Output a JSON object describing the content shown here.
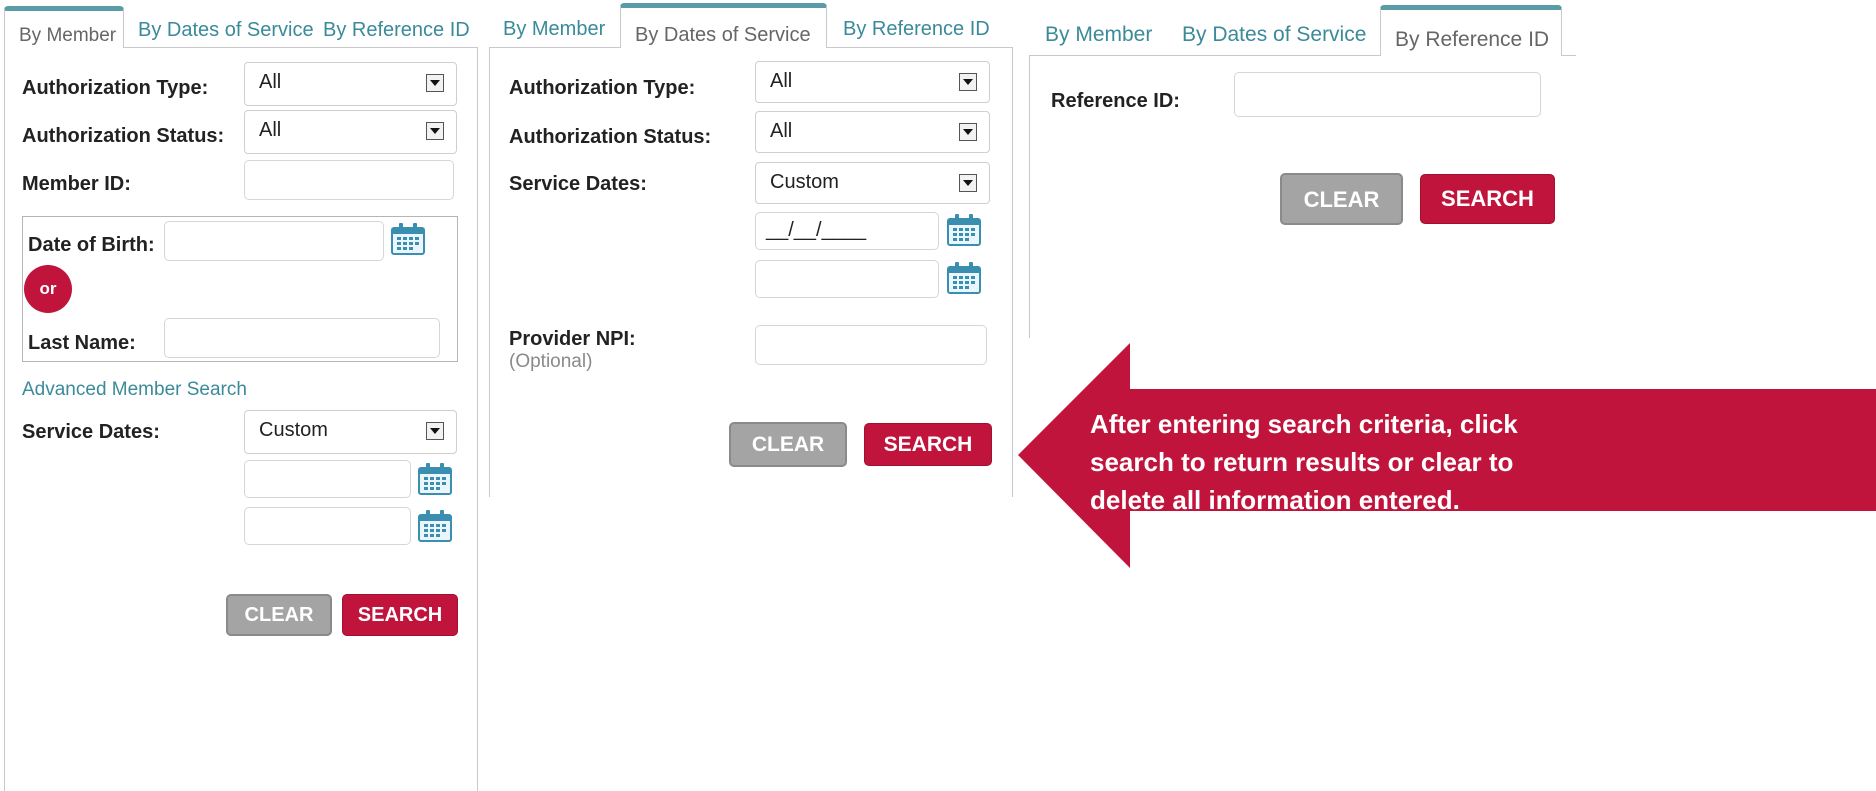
{
  "colors": {
    "accent": "#3a8a9a",
    "brand_red": "#c0143c",
    "button_gray": "#a4a4a4"
  },
  "panel1": {
    "tabs": [
      "By Member",
      "By Dates of Service",
      "By Reference ID"
    ],
    "auth_type_label": "Authorization Type:",
    "auth_type_value": "All",
    "auth_status_label": "Authorization Status:",
    "auth_status_value": "All",
    "member_id_label": "Member ID:",
    "member_id_value": "",
    "dob_label": "Date of Birth:",
    "dob_value": "",
    "or_label": "or",
    "last_name_label": "Last Name:",
    "last_name_value": "",
    "advanced_link": "Advanced Member Search",
    "service_dates_label": "Service Dates:",
    "service_dates_value": "Custom",
    "clear": "CLEAR",
    "search": "SEARCH"
  },
  "panel2": {
    "tabs": [
      "By Member",
      "By Dates of Service",
      "By Reference ID"
    ],
    "auth_type_label": "Authorization Type:",
    "auth_type_value": "All",
    "auth_status_label": "Authorization Status:",
    "auth_status_value": "All",
    "service_dates_label": "Service Dates:",
    "service_dates_value": "Custom",
    "start_date_mask": "__/__/____",
    "provider_npi_label": "Provider NPI:",
    "provider_npi_optional": "(Optional)",
    "clear": "CLEAR",
    "search": "SEARCH"
  },
  "panel3": {
    "tabs": [
      "By Member",
      "By Dates of Service",
      "By Reference ID"
    ],
    "reference_id_label": "Reference ID:",
    "reference_id_value": "",
    "clear": "CLEAR",
    "search": "SEARCH"
  },
  "callout": {
    "lines": [
      "After  entering search criteria, click",
      "search to return results or clear to",
      "delete all information entered."
    ]
  }
}
